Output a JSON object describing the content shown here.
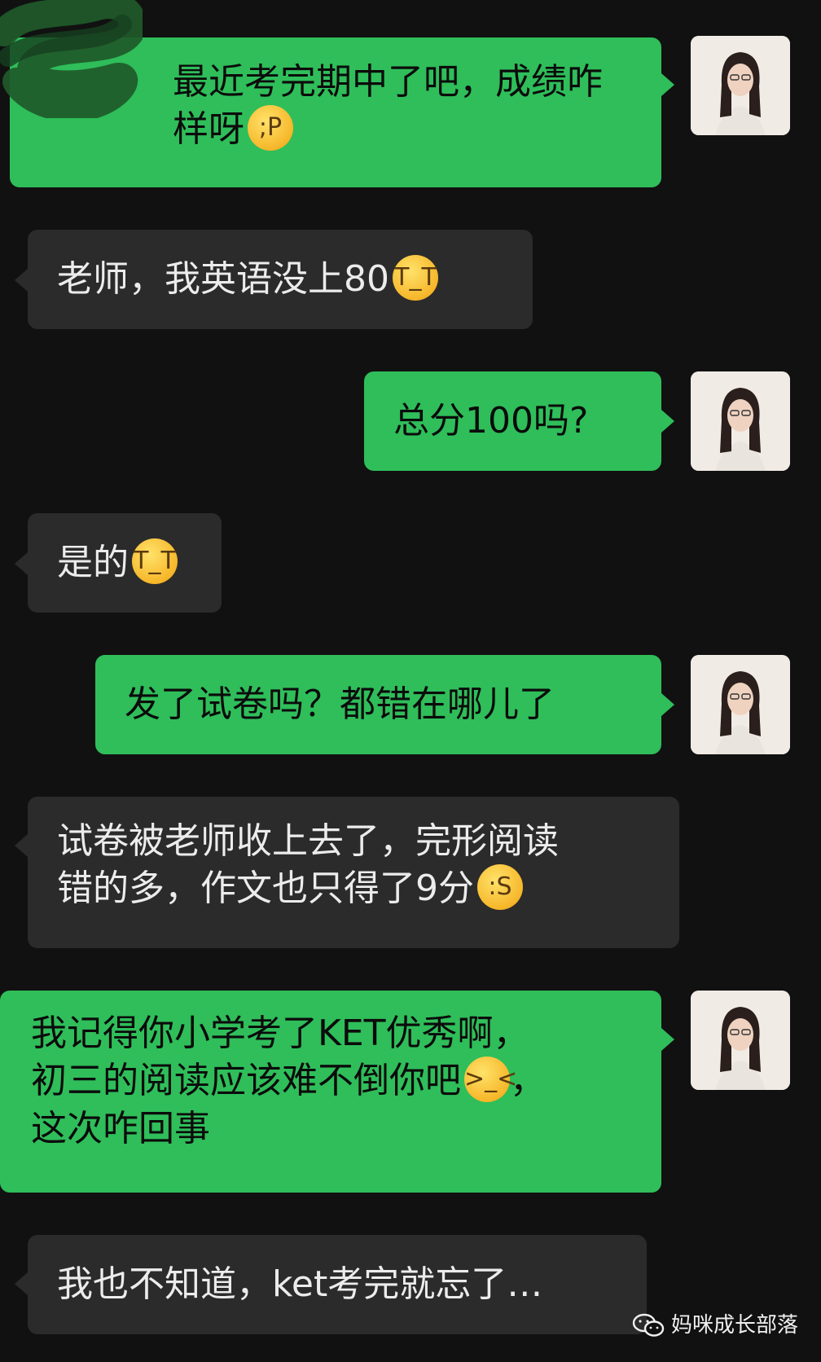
{
  "messages": [
    {
      "sender": "me",
      "text": "最近考完期中了吧，成绩咋样呀",
      "emoji": "winking-tongue-emoji"
    },
    {
      "sender": "them",
      "text": "老师，我英语没上80",
      "emoji": "crying-emoji"
    },
    {
      "sender": "me",
      "text": "总分100吗?"
    },
    {
      "sender": "them",
      "text": "是的",
      "emoji": "crying-emoji"
    },
    {
      "sender": "me",
      "text": "发了试卷吗？都错在哪儿了"
    },
    {
      "sender": "them",
      "text_line1": "试卷被老师收上去了，完形阅读",
      "text_line2": "错的多，作文也只得了9分",
      "emoji": "broken-face-emoji"
    },
    {
      "sender": "me",
      "text_line1": "我记得你小学考了KET优秀啊，",
      "text_line2": "初三的阅读应该难不倒你吧",
      "text_line2_tail": "，",
      "text_line3": "这次咋回事",
      "emoji": "facepalm-emoji"
    },
    {
      "sender": "them",
      "text": "我也不知道，ket考完就忘了…"
    }
  ],
  "watermark": {
    "text": "妈咪成长部落",
    "icon": "wechat-icon"
  },
  "colors": {
    "background": "#111111",
    "my_bubble": "#2fbe5a",
    "their_bubble": "#2b2b2b"
  }
}
